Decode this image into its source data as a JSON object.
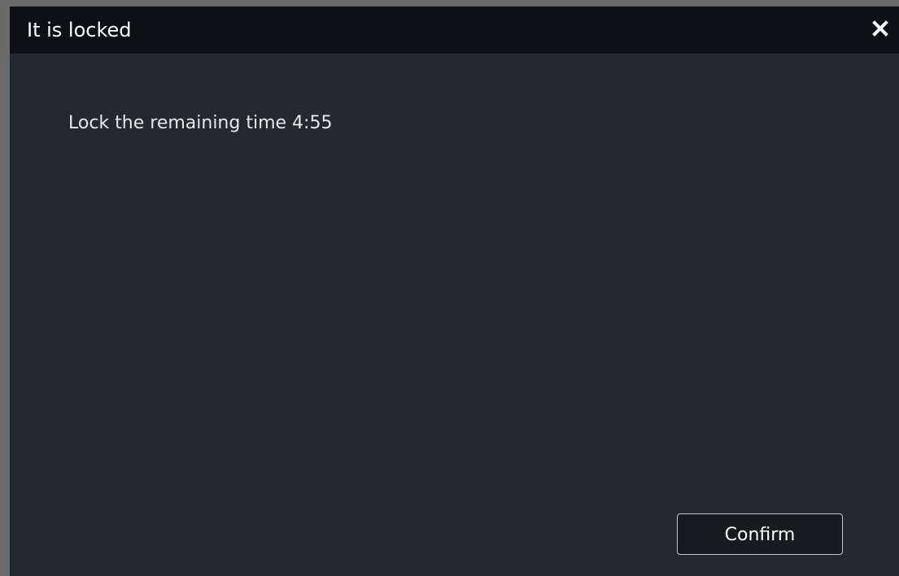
{
  "dialog": {
    "title": "It is locked",
    "close_icon": "close-icon",
    "message": "Lock the remaining time 4:55",
    "confirm_label": "Confirm"
  },
  "colors": {
    "title_bar": "#0d1116",
    "body": "#232930",
    "text": "#ffffff",
    "button_border": "#c4c7ca"
  }
}
